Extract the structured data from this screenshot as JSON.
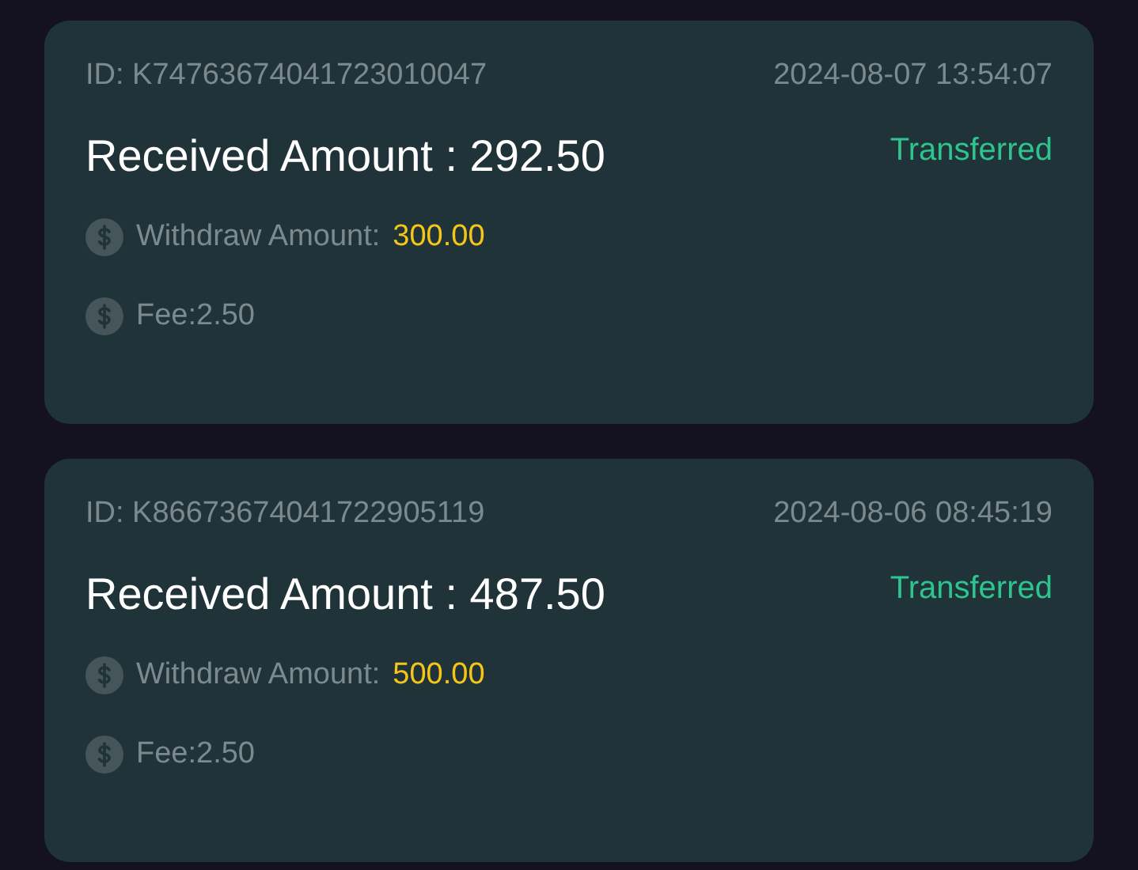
{
  "records": [
    {
      "id": "ID: K74763674041723010047",
      "time": "2024-08-07 13:54:07",
      "title": "Received Amount : 292.50",
      "status": "Transferred",
      "withdraw_label": "Withdraw Amount:",
      "withdraw_value": "300.00",
      "fee": "Fee:2.50"
    },
    {
      "id": "ID: K86673674041722905119",
      "time": "2024-08-06 08:45:19",
      "title": "Received Amount : 487.50",
      "status": "Transferred",
      "withdraw_label": "Withdraw Amount:",
      "withdraw_value": "500.00",
      "fee": "Fee:2.50"
    }
  ]
}
